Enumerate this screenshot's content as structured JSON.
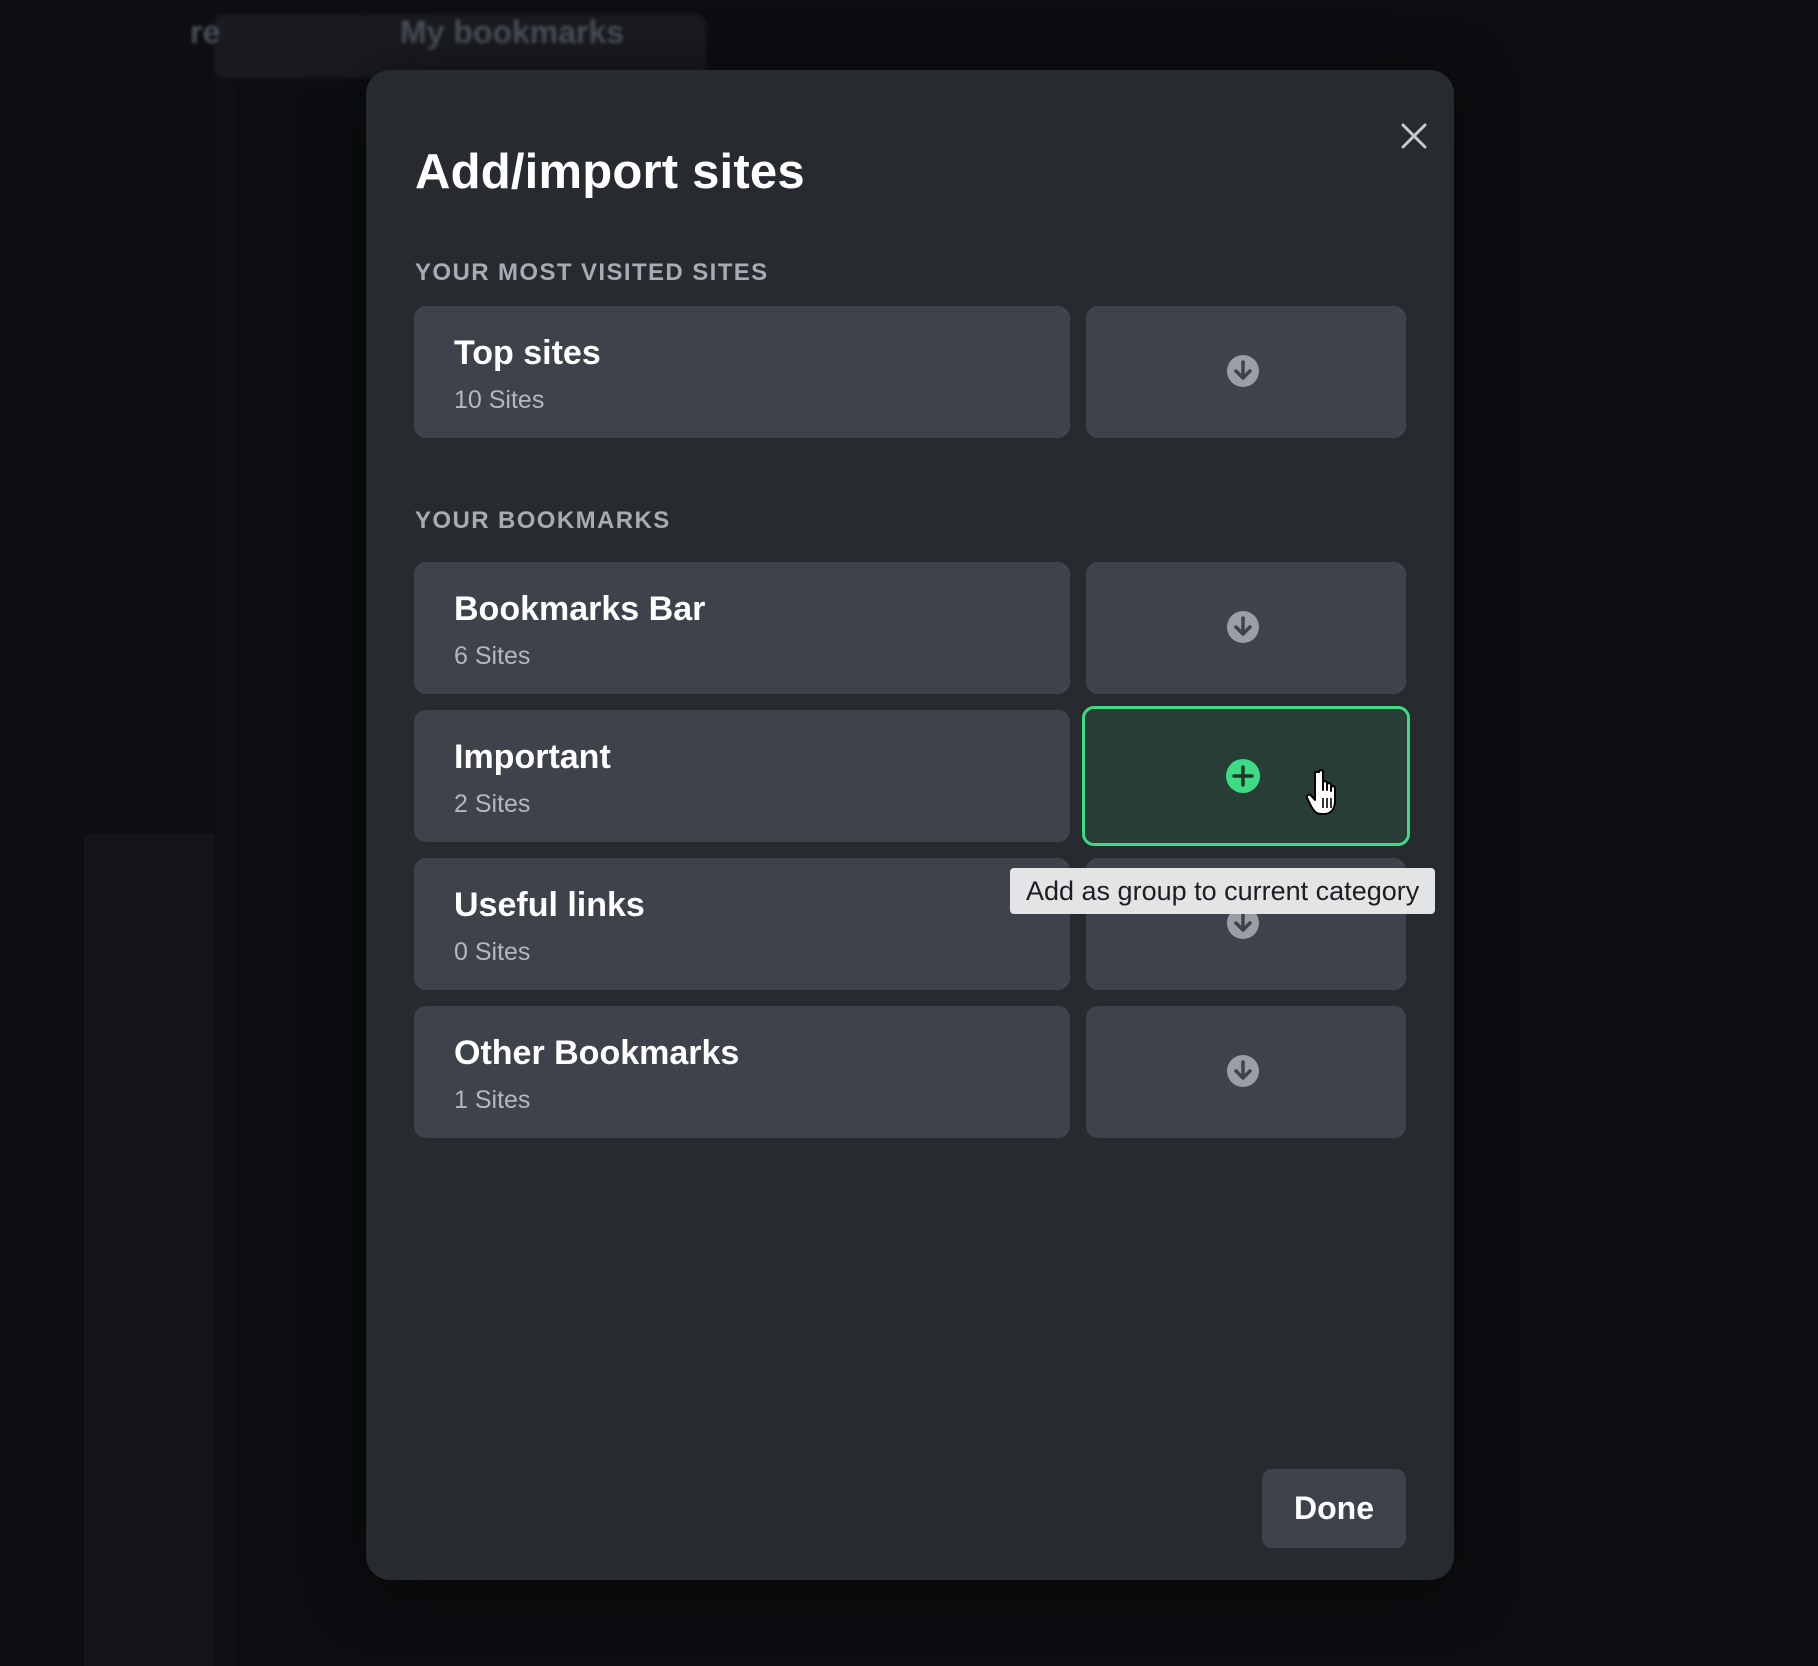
{
  "background": {
    "tabs": [
      "re",
      "My bookmarks"
    ]
  },
  "modal": {
    "title": "Add/import sites",
    "close_icon": "close-icon",
    "sections": [
      {
        "label": "YOUR MOST VISITED SITES",
        "items": [
          {
            "name": "Top sites",
            "count": "10 Sites",
            "action_icon": "download-icon"
          }
        ]
      },
      {
        "label": "YOUR BOOKMARKS",
        "items": [
          {
            "name": "Bookmarks Bar",
            "count": "6 Sites",
            "action_icon": "download-icon"
          },
          {
            "name": "Important",
            "count": "2 Sites",
            "action_icon": "plus-icon",
            "state": "hovered"
          },
          {
            "name": "Useful links",
            "count": "0 Sites",
            "action_icon": "download-icon"
          },
          {
            "name": "Other Bookmarks",
            "count": "1 Sites",
            "action_icon": "download-icon"
          }
        ]
      }
    ],
    "tooltip": "Add as group to current category",
    "done_label": "Done"
  },
  "colors": {
    "modal_bg": "#272b2f",
    "card_bg": "#3e434b",
    "accent_green": "#3ddc84",
    "hover_bg": "#283d36",
    "text_primary": "#ffffff",
    "text_secondary": "#b3b7be"
  }
}
